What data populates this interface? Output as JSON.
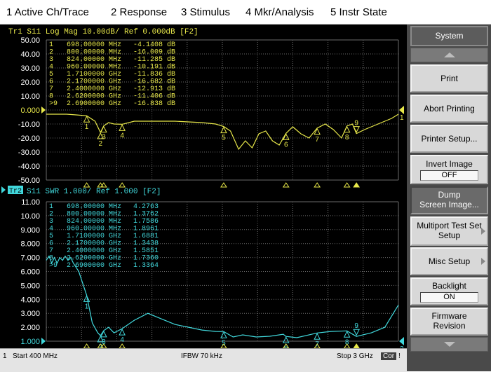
{
  "menu": [
    "1 Active Ch/Trace",
    "2 Response",
    "3 Stimulus",
    "4 Mkr/Analysis",
    "5 Instr State"
  ],
  "colors": {
    "trace1": "#e8e84a",
    "trace2": "#41d8dc",
    "grid": "#6a6a6a",
    "background": "#000000"
  },
  "top_plot": {
    "title": "Tr1  S11  Log Mag 10.00dB/ Ref 0.000dB [F2]",
    "y_ticks": [
      "50.00",
      "40.00",
      "30.00",
      "20.00",
      "10.00",
      "0.000",
      "-10.00",
      "-20.00",
      "-30.00",
      "-40.00",
      "-50.00"
    ],
    "markers": [
      {
        "n": "1",
        "freq": "698.00000 MHz",
        "val": "-4.1408 dB"
      },
      {
        "n": "2",
        "freq": "800.00000 MHz",
        "val": "-16.009 dB"
      },
      {
        "n": "3",
        "freq": "824.00000 MHz",
        "val": "-11.285 dB"
      },
      {
        "n": "4",
        "freq": "960.00000 MHz",
        "val": "-10.191 dB"
      },
      {
        "n": "5",
        "freq": "1.7100000 GHz",
        "val": "-11.836 dB"
      },
      {
        "n": "6",
        "freq": "2.1700000 GHz",
        "val": "-16.682 dB"
      },
      {
        "n": "7",
        "freq": "2.4000000 GHz",
        "val": "-12.913 dB"
      },
      {
        "n": "8",
        "freq": "2.6200000 GHz",
        "val": "-11.406 dB"
      },
      {
        "n": ">9",
        "freq": "2.6900000 GHz",
        "val": "-16.838 dB"
      }
    ],
    "ref_label": "1"
  },
  "bottom_plot": {
    "title": "S11  SWR 1.000/ Ref 1.000 [F2]",
    "badge": "Tr2",
    "y_ticks": [
      "11.00",
      "10.00",
      "9.000",
      "8.000",
      "7.000",
      "6.000",
      "5.000",
      "4.000",
      "3.000",
      "2.000",
      "1.000"
    ],
    "markers": [
      {
        "n": "1",
        "freq": "698.00000 MHz",
        "val": "4.2763"
      },
      {
        "n": "2",
        "freq": "800.00000 MHz",
        "val": "1.3762"
      },
      {
        "n": "3",
        "freq": "824.00000 MHz",
        "val": "1.7586"
      },
      {
        "n": "4",
        "freq": "960.00000 MHz",
        "val": "1.8961"
      },
      {
        "n": "5",
        "freq": "1.7100000 GHz",
        "val": "1.6881"
      },
      {
        "n": "6",
        "freq": "2.1700000 GHz",
        "val": "1.3438"
      },
      {
        "n": "7",
        "freq": "2.4000000 GHz",
        "val": "1.5851"
      },
      {
        "n": "8",
        "freq": "2.6200000 GHz",
        "val": "1.7360"
      },
      {
        "n": ">9",
        "freq": "2.6900000 GHz",
        "val": "1.3364"
      }
    ],
    "ref_label": "2"
  },
  "status": {
    "channel": "1",
    "start": "Start 400 MHz",
    "ifbw": "IFBW 70 kHz",
    "stop": "Stop 3 GHz",
    "cor": "Cor",
    "flag": "!"
  },
  "softkeys": {
    "title": "System",
    "print": "Print",
    "abort": "Abort Printing",
    "printer_setup": "Printer Setup...",
    "invert_image": "Invert Image",
    "invert_value": "OFF",
    "dump_line1": "Dump",
    "dump_line2": "Screen Image...",
    "multiport_line1": "Multiport Test Set",
    "multiport_line2": "Setup",
    "misc_setup": "Misc Setup",
    "backlight": "Backlight",
    "backlight_value": "ON",
    "firmware_line1": "Firmware",
    "firmware_line2": "Revision"
  },
  "chart_data": [
    {
      "type": "line",
      "title": "Tr1  S11  Log Mag 10.00dB/ Ref 0.000dB [F2]",
      "x_unit": "MHz",
      "xlim": [
        400,
        3000
      ],
      "ylim": [
        -50,
        50
      ],
      "series": [
        {
          "name": "S11 Log Mag",
          "x": [
            400,
            550,
            620,
            698,
            760,
            800,
            824,
            860,
            900,
            960,
            1050,
            1150,
            1250,
            1350,
            1450,
            1550,
            1650,
            1710,
            1760,
            1820,
            1870,
            1920,
            1970,
            2020,
            2070,
            2120,
            2170,
            2220,
            2280,
            2340,
            2400,
            2460,
            2520,
            2580,
            2620,
            2660,
            2690,
            2750,
            2850,
            2950,
            3000
          ],
          "y": [
            -3,
            -3,
            -3.5,
            -4.1,
            -8,
            -16,
            -11.3,
            -9,
            -10,
            -10.2,
            -8,
            -8,
            -8,
            -8,
            -8.5,
            -9,
            -10,
            -11.8,
            -15,
            -28,
            -22,
            -27,
            -17,
            -15,
            -22,
            -25,
            -16.7,
            -12,
            -17,
            -20,
            -12.9,
            -10,
            -14,
            -20,
            -11.4,
            -10,
            -16.8,
            -14,
            -10,
            -6,
            -3
          ]
        }
      ]
    },
    {
      "type": "line",
      "title": "S11  SWR 1.000/ Ref 1.000 [F2]",
      "x_unit": "MHz",
      "xlim": [
        400,
        3000
      ],
      "ylim": [
        1,
        11
      ],
      "series": [
        {
          "name": "S11 SWR",
          "x": [
            400,
            420,
            440,
            460,
            480,
            500,
            520,
            540,
            560,
            580,
            600,
            640,
            698,
            740,
            780,
            800,
            824,
            860,
            900,
            960,
            1050,
            1150,
            1250,
            1350,
            1450,
            1550,
            1650,
            1710,
            1780,
            1850,
            1950,
            2050,
            2150,
            2170,
            2250,
            2400,
            2500,
            2620,
            2690,
            2800,
            2900,
            3000
          ],
          "y": [
            6.8,
            7.1,
            6.6,
            7.0,
            6.6,
            7.0,
            6.8,
            7.1,
            6.8,
            7.0,
            6.6,
            6.0,
            4.3,
            2.3,
            1.6,
            1.4,
            1.76,
            2.0,
            1.6,
            1.9,
            2.5,
            3.0,
            2.6,
            2.2,
            2.0,
            1.8,
            1.7,
            1.69,
            1.3,
            1.45,
            1.3,
            1.35,
            1.5,
            1.34,
            1.25,
            1.59,
            1.7,
            1.74,
            1.34,
            1.6,
            2.0,
            3.6
          ]
        }
      ]
    }
  ]
}
